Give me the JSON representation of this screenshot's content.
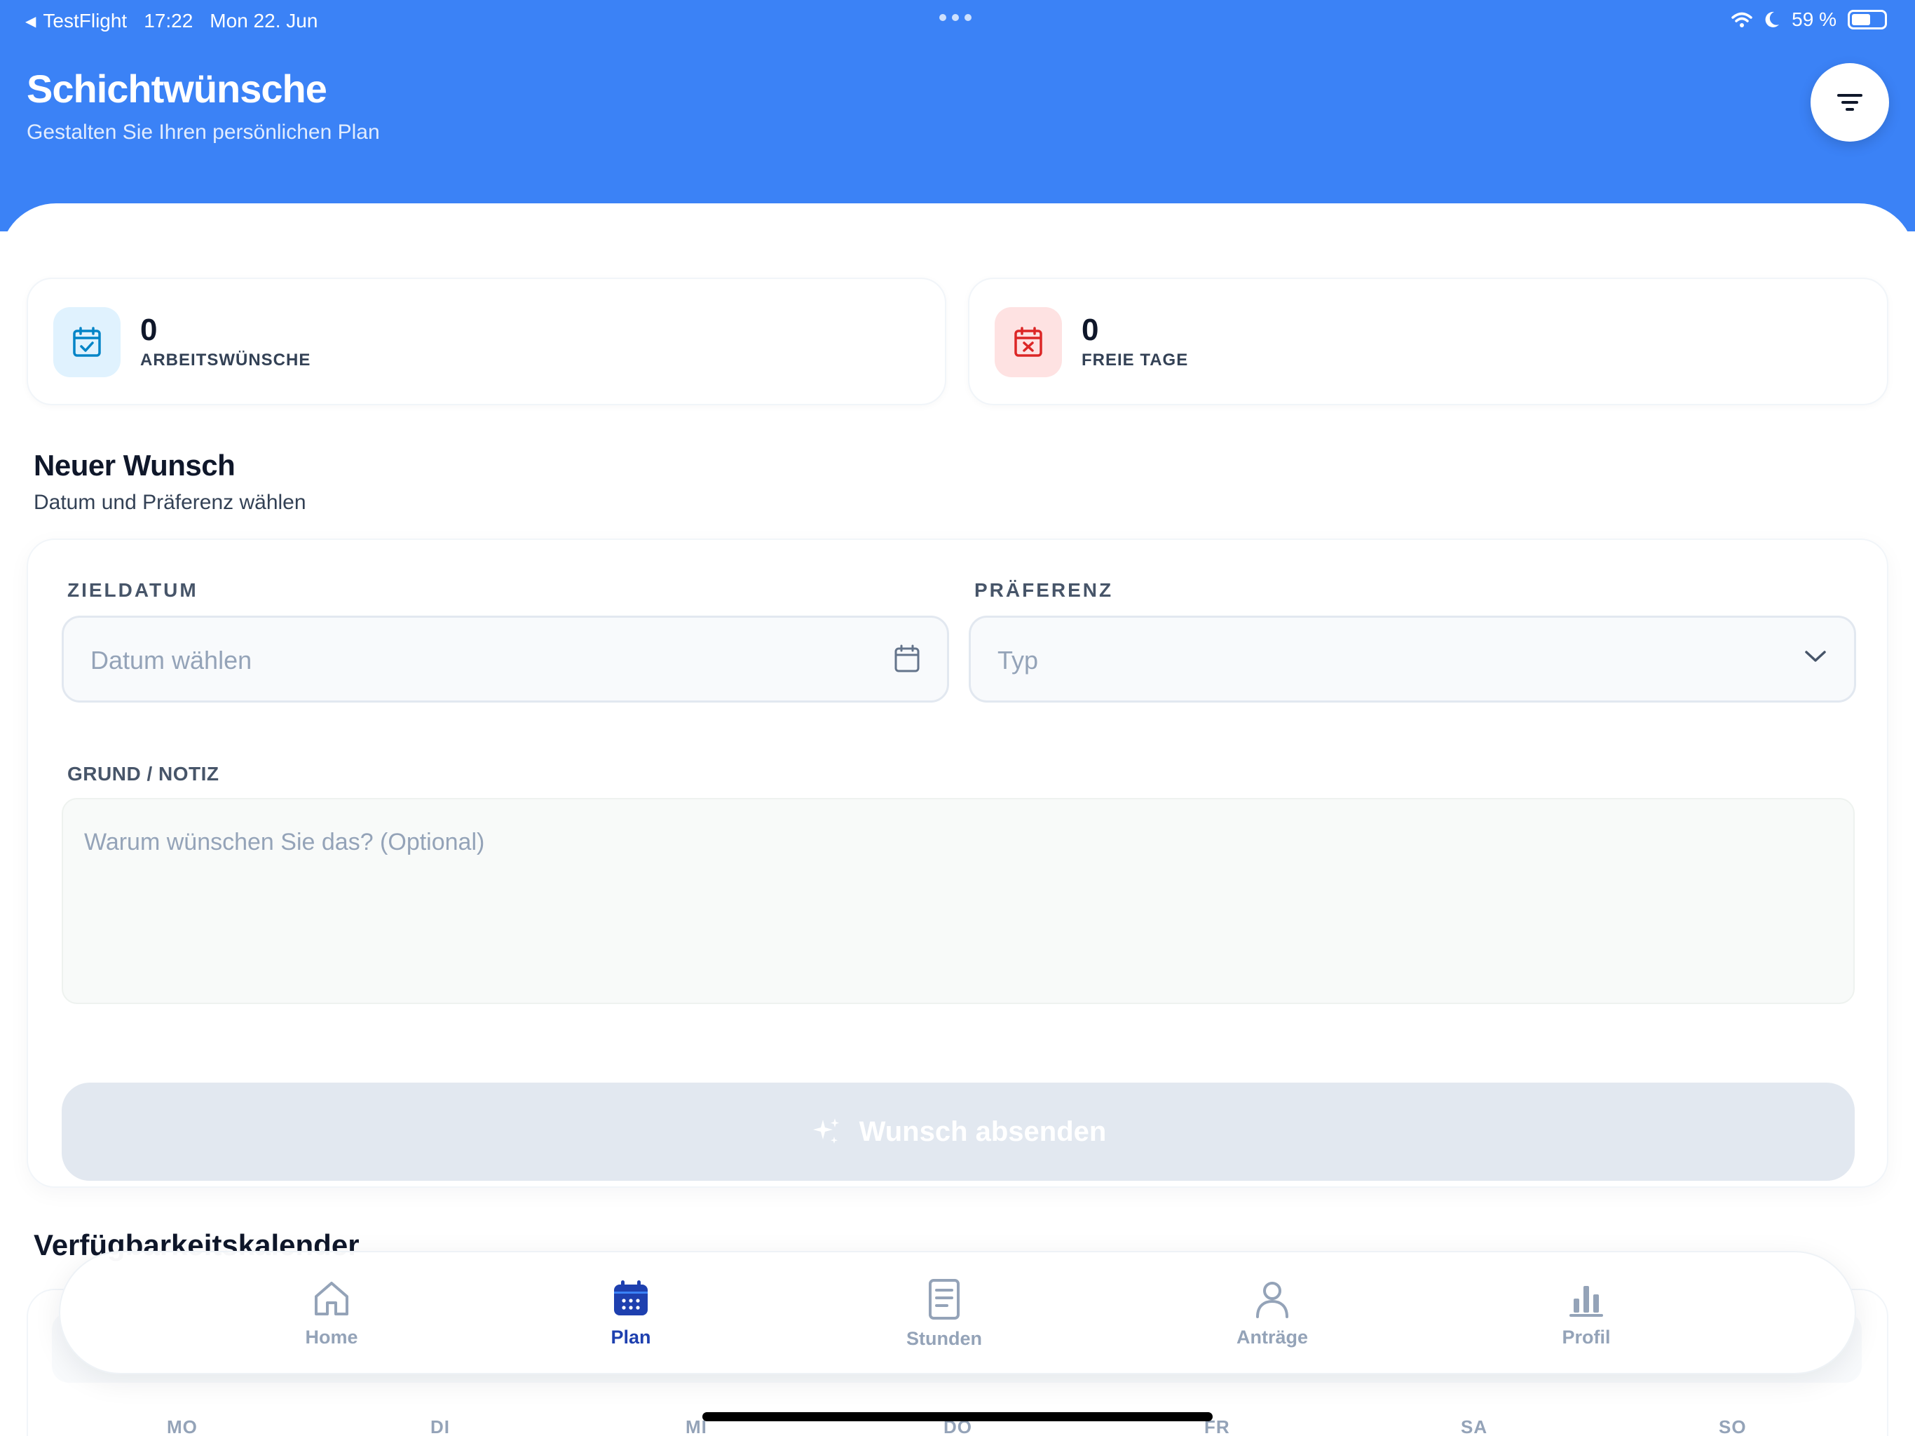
{
  "status_bar": {
    "back_app": "TestFlight",
    "time": "17:22",
    "date": "Mon 22. Jun",
    "battery_text": "59 %",
    "battery_level": 0.59
  },
  "header": {
    "title": "Schichtwünsche",
    "subtitle": "Gestalten Sie Ihren persönlichen Plan"
  },
  "stats": [
    {
      "value": "0",
      "label": "ARBEITSWÜNSCHE"
    },
    {
      "value": "0",
      "label": "FREIE TAGE"
    }
  ],
  "new_request": {
    "title": "Neuer Wunsch",
    "subtitle": "Datum und Präferenz wählen",
    "date_label": "ZIELDATUM",
    "date_placeholder": "Datum wählen",
    "preference_label": "PRÄFERENZ",
    "preference_placeholder": "Typ",
    "note_label": "GRUND / NOTIZ",
    "note_placeholder": "Warum wünschen Sie das? (Optional)",
    "submit_label": "Wunsch absenden"
  },
  "calendar": {
    "title": "Verfügbarkeitskalender",
    "weekdays": [
      "MO",
      "DI",
      "MI",
      "DO",
      "FR",
      "SA",
      "SO"
    ]
  },
  "tabbar": {
    "items": [
      {
        "label": "Home",
        "icon": "home-icon",
        "active": false
      },
      {
        "label": "Plan",
        "icon": "calendar-icon",
        "active": true
      },
      {
        "label": "Stunden",
        "icon": "document-icon",
        "active": false
      },
      {
        "label": "Anträge",
        "icon": "user-icon",
        "active": false
      },
      {
        "label": "Profil",
        "icon": "bar-chart-icon",
        "active": false
      }
    ]
  },
  "colors": {
    "primary": "#3b82f6",
    "active_tab": "#1e40af",
    "work_icon": "#0284c7",
    "free_icon": "#dc2626"
  }
}
